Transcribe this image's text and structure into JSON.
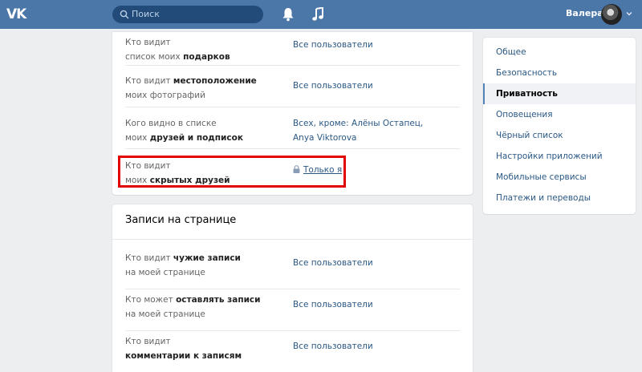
{
  "header": {
    "logo": "VK",
    "search_placeholder": "Поиск",
    "username": "Валера"
  },
  "privacy_rows": [
    {
      "q1": "Кто видит",
      "q2_plain": "список моих ",
      "q2_bold": "подарков",
      "value": "Все пользователи"
    },
    {
      "q1_plain": "Кто видит ",
      "q1_bold": "местоположение",
      "q2": "моих фотографий",
      "value": "Все пользователи"
    },
    {
      "q1": "Кого видно в списке",
      "q2_plain": "моих ",
      "q2_bold": "друзей и подписок",
      "value": "Всех, кроме: Алёны Остапец, Anya Viktorova"
    },
    {
      "q1": "Кто видит",
      "q2_plain": "моих ",
      "q2_bold": "скрытых друзей",
      "value": "Только я"
    }
  ],
  "posts_section": {
    "title": "Записи на странице",
    "rows": [
      {
        "q1_plain": "Кто видит ",
        "q1_bold": "чужие записи",
        "q2": "на моей странице",
        "value": "Все пользователи"
      },
      {
        "q1_plain": "Кто может ",
        "q1_bold": "оставлять записи",
        "q2": "на моей странице",
        "value": "Все пользователи"
      },
      {
        "q1": "Кто видит",
        "q2_bold": "комментарии к записям",
        "value": "Все пользователи"
      }
    ]
  },
  "menu": {
    "items": [
      "Общее",
      "Безопасность",
      "Приватность",
      "Оповещения",
      "Чёрный список",
      "Настройки приложений",
      "Мобильные сервисы",
      "Платежи и переводы"
    ],
    "active": "Приватность"
  },
  "colors": {
    "header": "#4a76a8",
    "link": "#2a5885",
    "highlight": "#e30000"
  }
}
